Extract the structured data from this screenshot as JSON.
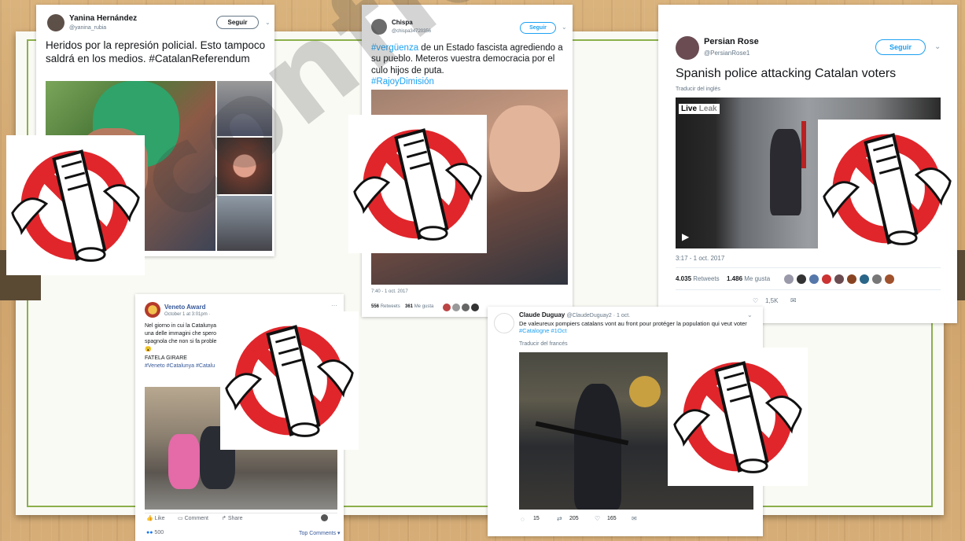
{
  "colors": {
    "accent": "#1da1f2",
    "slide_border": "#8bb04a",
    "ban_red": "#e0262b"
  },
  "watermark": {
    "text": "confidencial"
  },
  "tweets": {
    "yanina": {
      "name": "Yanina Hernández",
      "handle": "@yanina_rubia",
      "follow": "Seguir",
      "text": "Heridos por la represión policial. Esto tampoco saldrá en los medios. #CatalanReferendum"
    },
    "chispa": {
      "name": "Chispa",
      "handle": "@chispa34720356",
      "follow": "Seguir",
      "hashtag1": "#vergüenza",
      "text": " de un Estado fascista agrediendo a su pueblo. Meteros vuestra democracia por el culo hijos de puta.",
      "hashtag2": "#RajoyDimisión",
      "date": "7:40 - 1 oct. 2017",
      "retweets": "556",
      "retweets_label": "Retweets",
      "likes": "361",
      "likes_label": "Me gusta"
    },
    "persian": {
      "name": "Persian Rose",
      "handle": "@PersianRose1",
      "follow": "Seguir",
      "text": "Spanish police attacking Catalan voters",
      "translate": "Traducir del inglés",
      "live": "Live",
      "live2": "Leak",
      "date": "3:17 - 1 oct. 2017",
      "retweets": "4.035",
      "retweets_label": "Retweets",
      "likes": "1.486",
      "likes_label": "Me gusta",
      "likes_count": "1,5K"
    },
    "veneto": {
      "name": "Veneto Award",
      "time": "October 1 at 3:01pm · ",
      "line1": "Nel giorno in cui la Catalunya",
      "line2": "una delle immagini che spero",
      "line3": "spagnola che non si fa proble",
      "line4": "FATELA GIRARE",
      "hashtags": "#Veneto #Catalunya #Catalu",
      "like": "Like",
      "comment": "Comment",
      "share": "Share",
      "reactions": "500",
      "top_comments": "Top Comments ▾"
    },
    "claude": {
      "name": "Claude Duguay",
      "handle": "@ClaudeDuguay2 · 1 oct.",
      "text": "De valeureux pompiers catalans vont au front pour protéger la population qui veut voter ",
      "hashtags": "#Catalogne #1Oct",
      "translate": "Traducir del francés",
      "replies": "15",
      "retweets": "205",
      "likes": "165"
    }
  }
}
